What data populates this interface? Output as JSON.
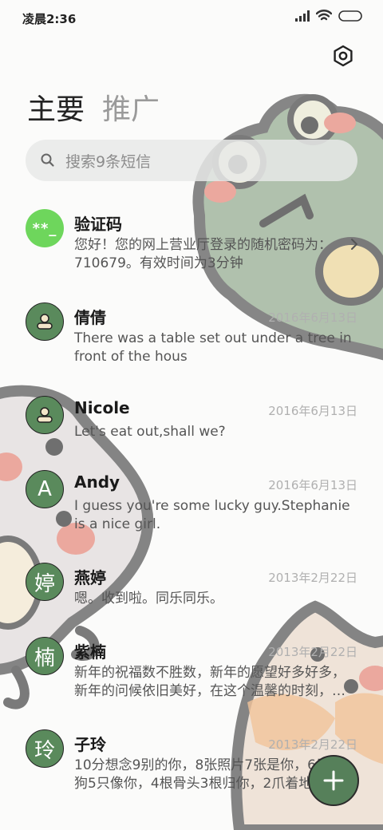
{
  "status_bar": {
    "time": "凌晨2:36"
  },
  "tabs": {
    "primary": "主要",
    "secondary": "推广"
  },
  "search": {
    "placeholder": "搜索9条短信"
  },
  "conversations": [
    {
      "name": "验证码",
      "avatar_text": "**_",
      "date": "",
      "preview": "您好！您的网上营业厅登录的随机密码为：710679。有效时间为3分钟"
    },
    {
      "name": "倩倩",
      "avatar_text": "",
      "date": "2016年6月13日",
      "preview": "There was a table set out under a tree in front of the hous"
    },
    {
      "name": "Nicole",
      "avatar_text": "",
      "date": "2016年6月13日",
      "preview": "Let's eat out,shall we?"
    },
    {
      "name": "Andy",
      "avatar_text": "A",
      "date": "2016年6月13日",
      "preview": "I guess you're some lucky guy.Stephanie is a nice girl."
    },
    {
      "name": "燕婷",
      "avatar_text": "婷",
      "date": "2013年2月22日",
      "preview": "嗯。收到啦。同乐同乐。"
    },
    {
      "name": "紫楠",
      "avatar_text": "楠",
      "date": "2013年2月22日",
      "preview": "新年的祝福数不胜数，新年的愿望好多好多，新年的问候依旧美好，在这个温馨的时刻，…"
    },
    {
      "name": "子玲",
      "avatar_text": "玲",
      "date": "2013年2月22日",
      "preview": "10分想念9别的你，8张照片7张是你，6只小狗5只像你，4根骨头3根归你，2爪着地1个…"
    }
  ],
  "fab": {
    "label": "+"
  },
  "icons": {
    "settings": "settings-icon",
    "search": "search-icon",
    "contact": "person-icon",
    "chevron": "chevron-right-icon",
    "signal": "signal-icon",
    "wifi": "wifi-icon",
    "battery": "battery-icon"
  },
  "colors": {
    "avatar_green": "#5a8a5c",
    "code_avatar": "#6ed65c",
    "fab": "#56805a"
  }
}
